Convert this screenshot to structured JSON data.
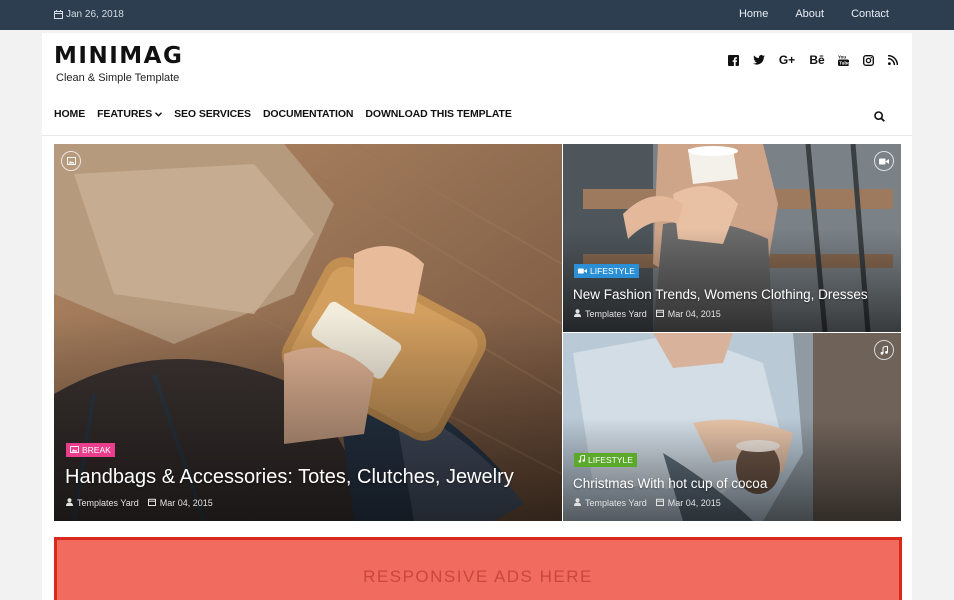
{
  "topbar": {
    "date": "Jan 26, 2018",
    "links": [
      "Home",
      "About",
      "Contact"
    ]
  },
  "brand": {
    "logo": "MINIMAG",
    "tagline": "Clean & Simple Template"
  },
  "social_icons": [
    "facebook-icon",
    "twitter-icon",
    "google-plus-icon",
    "behance-icon",
    "youtube-icon",
    "instagram-icon",
    "rss-icon"
  ],
  "social_glyphs": {
    "google_plus": "G+",
    "behance": "Bē"
  },
  "nav": {
    "items": [
      "HOME",
      "FEATURES",
      "SEO SERVICES",
      "DOCUMENTATION",
      "DOWNLOAD THIS TEMPLATE"
    ]
  },
  "featured": [
    {
      "badge": "BREAK",
      "badge_color": "#e83e8c",
      "badge_icon": "image-icon",
      "media_icon": "image-icon",
      "title": "Handbags & Accessories: Totes, Clutches, Jewelry",
      "author": "Templates Yard",
      "date": "Mar 04, 2015"
    },
    {
      "badge": "LIFESTYLE",
      "badge_color": "#2b8fd6",
      "badge_icon": "video-icon",
      "media_icon": "video-icon",
      "title": "New Fashion Trends, Womens Clothing, Dresses",
      "author": "Templates Yard",
      "date": "Mar 04, 2015"
    },
    {
      "badge": "LIFESTYLE",
      "badge_color": "#5aa92a",
      "badge_icon": "music-icon",
      "media_icon": "music-icon",
      "title": "Christmas With hot cup of cocoa",
      "author": "Templates Yard",
      "date": "Mar 04, 2015"
    }
  ],
  "ads": {
    "label": "RESPONSIVE ADS HERE",
    "bg_color": "#f16b5f",
    "border_color": "#d9291c"
  },
  "colors": {
    "topbar": "#2c3e50"
  }
}
